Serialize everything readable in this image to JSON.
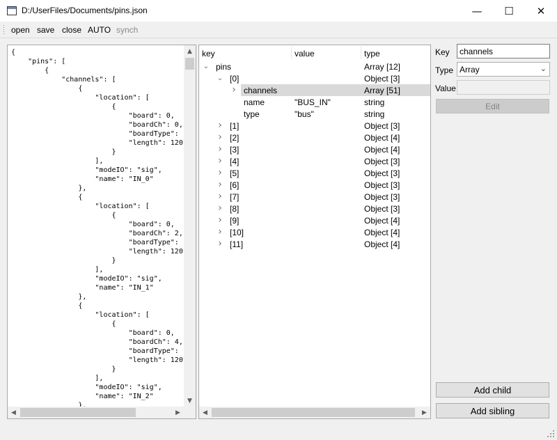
{
  "window": {
    "title": "D:/UserFiles/Documents/pins.json",
    "controls": {
      "minimize": "—",
      "maximize": "☐",
      "close": "✕"
    }
  },
  "toolbar": {
    "open": "open",
    "save": "save",
    "close": "close",
    "auto": "AUTO",
    "synch": "synch"
  },
  "editor": {
    "lines": [
      "{",
      "    \"pins\": [",
      "        {",
      "            \"channels\": [",
      "                {",
      "                    \"location\": [",
      "                        {",
      "                            \"board\": 0,",
      "                            \"boardCh\": 0,",
      "                            \"boardType\": \"",
      "                            \"length\": 120",
      "                        }",
      "                    ],",
      "                    \"modeIO\": \"sig\",",
      "                    \"name\": \"IN_0\"",
      "                },",
      "                {",
      "                    \"location\": [",
      "                        {",
      "                            \"board\": 0,",
      "                            \"boardCh\": 2,",
      "                            \"boardType\": \"",
      "                            \"length\": 120",
      "                        }",
      "                    ],",
      "                    \"modeIO\": \"sig\",",
      "                    \"name\": \"IN_1\"",
      "                },",
      "                {",
      "                    \"location\": [",
      "                        {",
      "                            \"board\": 0,",
      "                            \"boardCh\": 4,",
      "                            \"boardType\": \"",
      "                            \"length\": 120",
      "                        }",
      "                    ],",
      "                    \"modeIO\": \"sig\",",
      "                    \"name\": \"IN_2\"",
      "                },"
    ]
  },
  "tree": {
    "columns": {
      "key": "key",
      "value": "value",
      "type": "type"
    },
    "rows": [
      {
        "depth": 0,
        "expander": "open",
        "key": "pins",
        "value": "",
        "type": "Array [12]"
      },
      {
        "depth": 1,
        "expander": "open",
        "key": "[0]",
        "value": "",
        "type": "Object [3]"
      },
      {
        "depth": 2,
        "expander": "closed",
        "key": "channels",
        "value": "",
        "type": "Array [51]",
        "selected": true
      },
      {
        "depth": 2,
        "expander": "none",
        "key": "name",
        "value": "\"BUS_IN\"",
        "type": "string"
      },
      {
        "depth": 2,
        "expander": "none",
        "key": "type",
        "value": "\"bus\"",
        "type": "string"
      },
      {
        "depth": 1,
        "expander": "closed",
        "key": "[1]",
        "value": "",
        "type": "Object [3]"
      },
      {
        "depth": 1,
        "expander": "closed",
        "key": "[2]",
        "value": "",
        "type": "Object [4]"
      },
      {
        "depth": 1,
        "expander": "closed",
        "key": "[3]",
        "value": "",
        "type": "Object [4]"
      },
      {
        "depth": 1,
        "expander": "closed",
        "key": "[4]",
        "value": "",
        "type": "Object [3]"
      },
      {
        "depth": 1,
        "expander": "closed",
        "key": "[5]",
        "value": "",
        "type": "Object [3]"
      },
      {
        "depth": 1,
        "expander": "closed",
        "key": "[6]",
        "value": "",
        "type": "Object [3]"
      },
      {
        "depth": 1,
        "expander": "closed",
        "key": "[7]",
        "value": "",
        "type": "Object [3]"
      },
      {
        "depth": 1,
        "expander": "closed",
        "key": "[8]",
        "value": "",
        "type": "Object [3]"
      },
      {
        "depth": 1,
        "expander": "closed",
        "key": "[9]",
        "value": "",
        "type": "Object [4]"
      },
      {
        "depth": 1,
        "expander": "closed",
        "key": "[10]",
        "value": "",
        "type": "Object [4]"
      },
      {
        "depth": 1,
        "expander": "closed",
        "key": "[11]",
        "value": "",
        "type": "Object [4]"
      }
    ]
  },
  "properties": {
    "key_label": "Key",
    "key_value": "channels",
    "type_label": "Type",
    "type_value": "Array",
    "value_label": "Value",
    "value_value": "",
    "edit_label": "Edit",
    "add_child_label": "Add child",
    "add_sibling_label": "Add sibling"
  },
  "icons": {
    "app": "app-window-icon",
    "scroll_up": "scroll-up-icon",
    "scroll_down": "scroll-down-icon",
    "scroll_left": "scroll-left-icon",
    "scroll_right": "scroll-right-icon",
    "expanded": "chevron-down-icon",
    "collapsed": "chevron-right-icon",
    "dropdown": "chevron-down-icon",
    "size_grip": "size-grip-icon"
  },
  "colors": {
    "selection": "#d9d9d9",
    "disabled_text": "#8a8a8a",
    "window_bg": "#f0f0f0"
  }
}
